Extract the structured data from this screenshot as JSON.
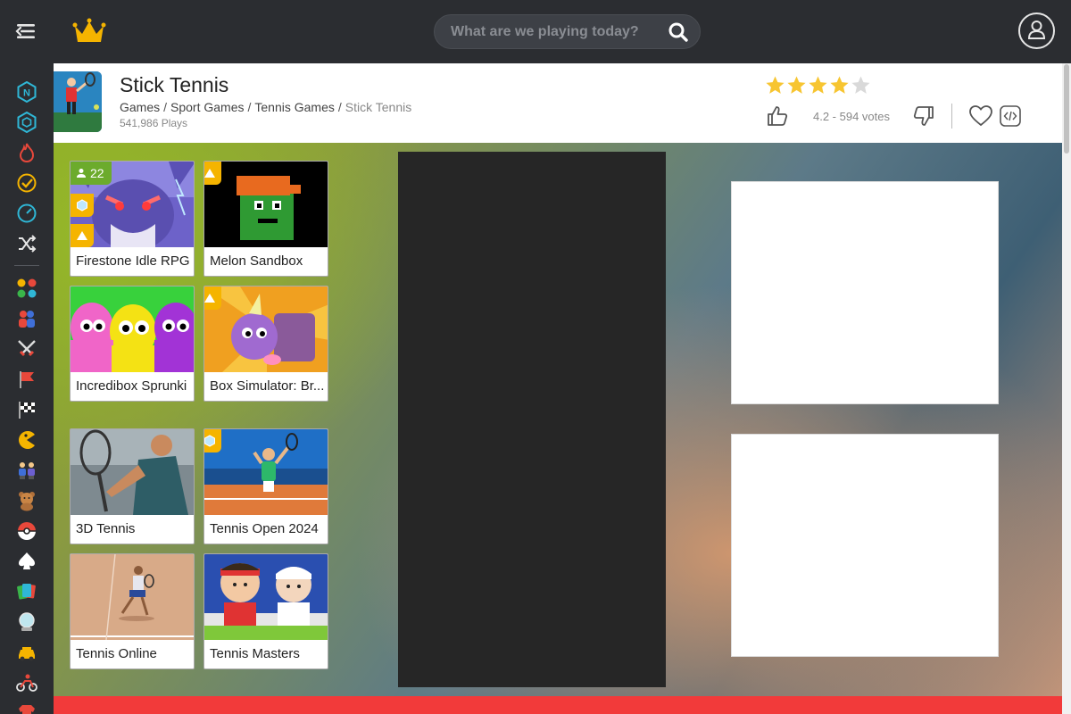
{
  "header": {
    "search_placeholder": "What are we playing today?"
  },
  "game": {
    "title": "Stick Tennis",
    "breadcrumb": [
      "Games",
      "Sport Games",
      "Tennis Games"
    ],
    "breadcrumb_current": "Stick Tennis",
    "plays": "541,986 Plays",
    "rating": 4.2,
    "votes_text": "4.2 - 594 votes",
    "stars_filled": 4,
    "stars_total": 5
  },
  "sidebar": {
    "items": [
      "new-games-icon",
      "hexagon-icon",
      "fire-icon",
      "check-circle-icon",
      "speedometer-icon",
      "shuffle-icon",
      "categories-icon",
      "two-player-icon",
      "swords-icon",
      "flag-icon",
      "racing-flag-icon",
      "pacman-icon",
      "multiplayer-icon",
      "teddy-bear-icon",
      "pokeball-icon",
      "spade-icon",
      "cards-icon",
      "crystal-ball-icon",
      "car-icon",
      "bike-icon",
      "shirt-icon"
    ]
  },
  "cards": [
    {
      "label": "Firestone Idle RPG",
      "count": "22"
    },
    {
      "label": "Melon Sandbox"
    },
    {
      "label": "Incredibox Sprunki"
    },
    {
      "label": "Box Simulator: Br..."
    },
    {
      "label": "3D Tennis"
    },
    {
      "label": "Tennis Open 2024"
    },
    {
      "label": "Tennis Online"
    },
    {
      "label": "Tennis Masters"
    }
  ],
  "colors": {
    "topbar": "#2b2d31",
    "accent_yellow": "#f5b400",
    "star_filled": "#f7c531",
    "star_empty": "#d9d9d9",
    "bottom_bar": "#f23a3a",
    "count_badge": "#6cab2c"
  }
}
